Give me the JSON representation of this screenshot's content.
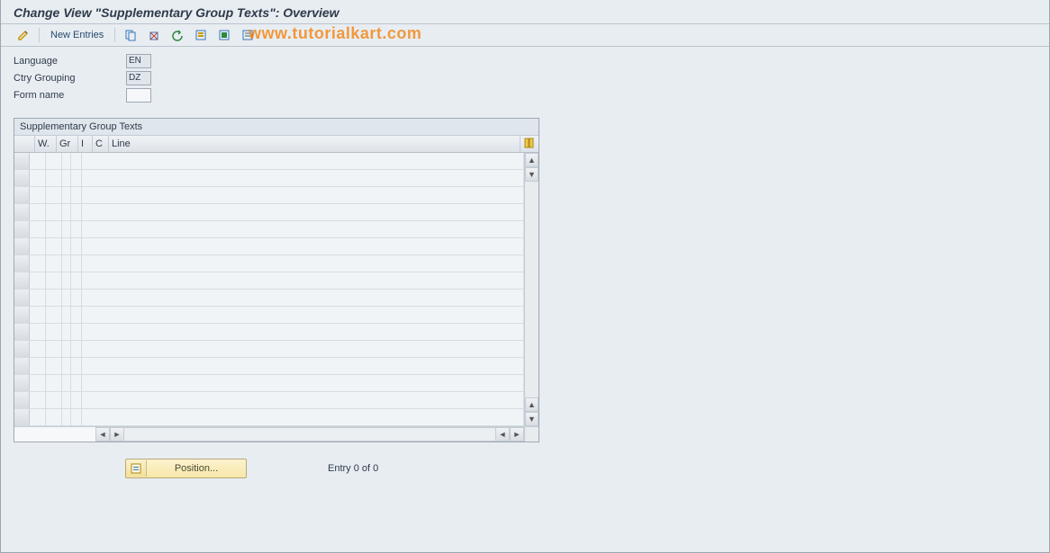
{
  "title": "Change View \"Supplementary Group Texts\": Overview",
  "toolbar": {
    "new_entries": "New Entries"
  },
  "watermark": "www.tutorialkart.com",
  "fields": {
    "language_label": "Language",
    "language_value": "EN",
    "ctry_label": "Ctry Grouping",
    "ctry_value": "DZ",
    "form_label": "Form name",
    "form_value": ""
  },
  "table": {
    "title": "Supplementary Group Texts",
    "columns": {
      "w": "W.",
      "gr": "Gr",
      "i": "I",
      "c": "C",
      "line": "Line"
    },
    "row_count": 16
  },
  "footer": {
    "position_label": "Position...",
    "entry_status": "Entry 0 of 0"
  }
}
